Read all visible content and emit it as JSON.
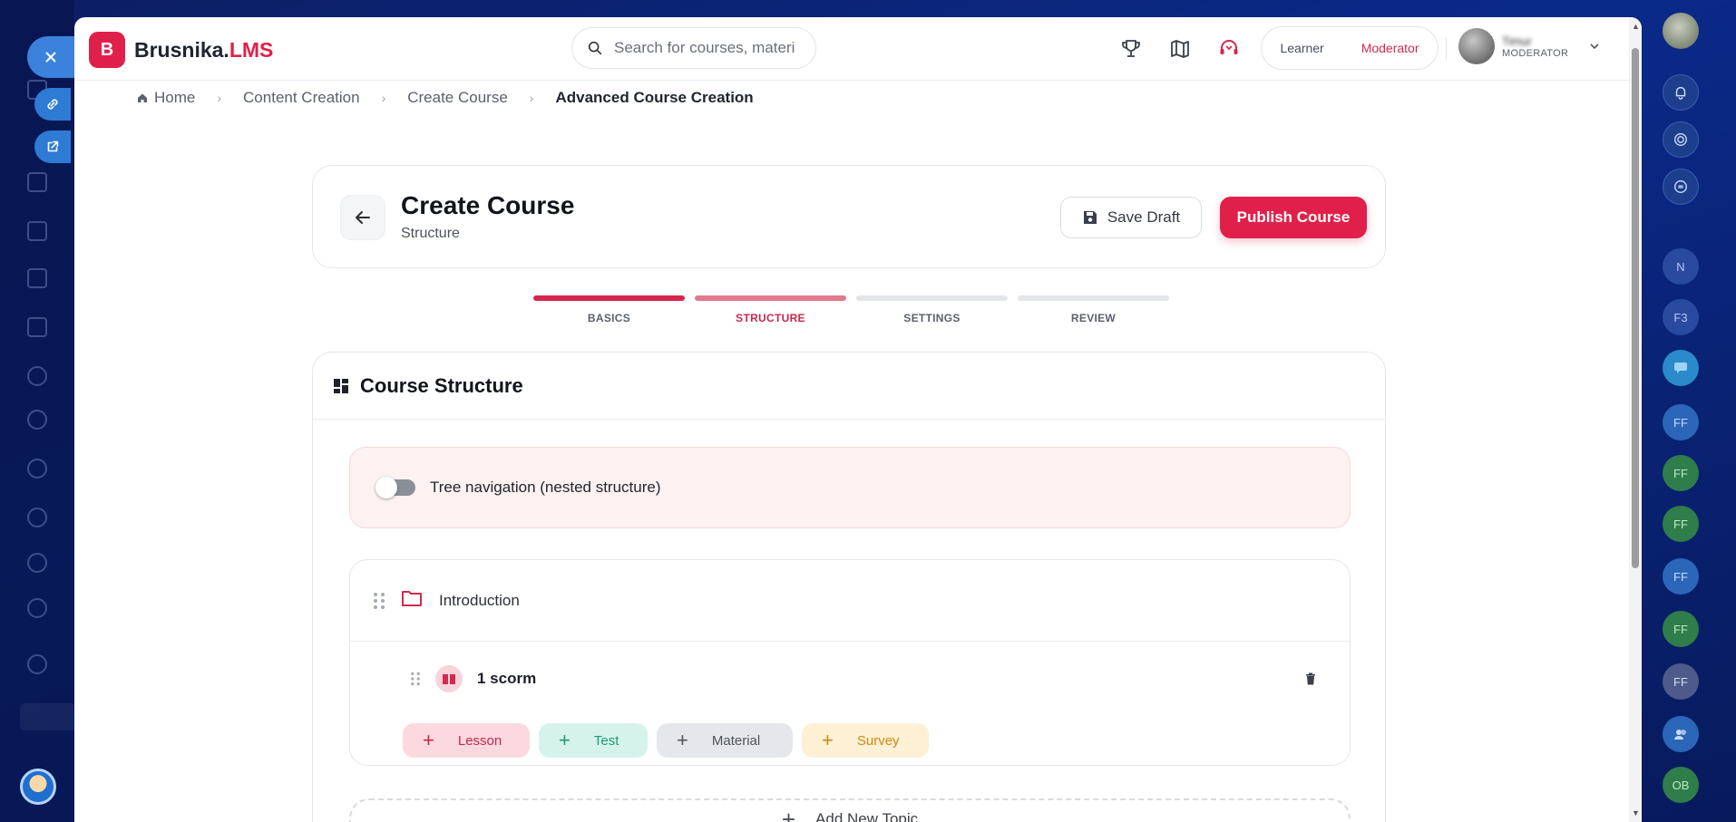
{
  "app": {
    "logo_letter": "B",
    "logo_name": "Brusnika.",
    "logo_suffix": "LMS",
    "brand_color": "#e0204a"
  },
  "search": {
    "placeholder": "Search for courses, materi"
  },
  "top_icons": [
    "trophy-icon",
    "map-icon",
    "support-headset-icon"
  ],
  "roles": {
    "learner": "Learner",
    "moderator": "Moderator",
    "active": "Moderator"
  },
  "user": {
    "name": "Timur",
    "role": "MODERATOR"
  },
  "breadcrumb": {
    "home": "Home",
    "items": [
      "Content Creation",
      "Create Course",
      "Advanced Course Creation"
    ]
  },
  "header": {
    "title": "Create Course",
    "subtitle": "Structure",
    "save_label": "Save Draft",
    "publish_label": "Publish Course"
  },
  "steps": [
    {
      "label": "BASICS",
      "state": "done"
    },
    {
      "label": "STRUCTURE",
      "state": "active"
    },
    {
      "label": "SETTINGS",
      "state": "todo"
    },
    {
      "label": "REVIEW",
      "state": "todo"
    }
  ],
  "structure": {
    "title": "Course Structure",
    "tree_toggle_label": "Tree navigation (nested structure)",
    "tree_toggle_on": false,
    "topics": [
      {
        "name": "Introduction",
        "lessons": [
          {
            "name": "1 scorm"
          }
        ],
        "add_buttons": {
          "lesson": "Lesson",
          "test": "Test",
          "material": "Material",
          "survey": "Survey"
        }
      }
    ],
    "add_topic_label": "Add New Topic"
  },
  "right_rail": {
    "labels": [
      "N",
      "F3",
      "FF",
      "FF",
      "FF",
      "FF",
      "FF",
      "FF",
      "OB"
    ]
  }
}
